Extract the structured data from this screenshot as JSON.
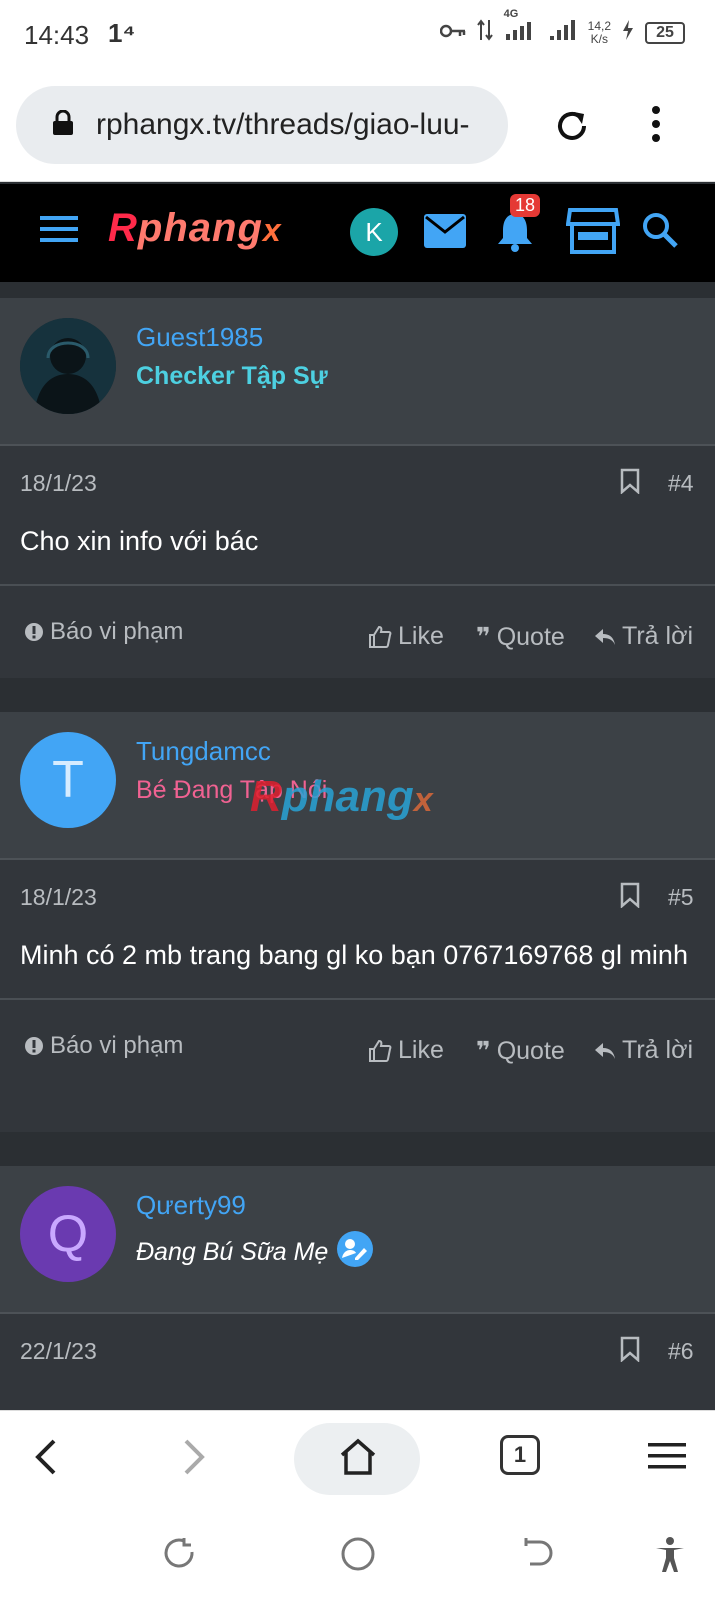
{
  "status_bar": {
    "time": "14:43",
    "extra": "1⁴",
    "network": "4G",
    "speed_value": "14,2",
    "speed_unit": "K/s",
    "battery": "25"
  },
  "browser": {
    "url": "rphangx.tv/threads/giao-luu-"
  },
  "site": {
    "logo_r": "R",
    "logo_phang": "phang",
    "logo_x": "x",
    "user_initial": "K",
    "notification_count": "18"
  },
  "posts": [
    {
      "username": "Guest1985",
      "title": "Checker Tập Sự",
      "title_color": "#4dd0e1",
      "date": "18/1/23",
      "number": "#4",
      "body": "Cho xin info với bác"
    },
    {
      "username": "Tungdamcc",
      "title": "Bé Đang Tập Nói",
      "title_color": "#f06292",
      "avatar_letter": "T",
      "avatar_color": "#42a5f5",
      "date": "18/1/23",
      "number": "#5",
      "body": "Minh có 2 mb trang bang gl ko bạn 0767169768 gl minh"
    },
    {
      "username": "Qưerty99",
      "title": "Đang Bú Sữa Mẹ",
      "title_color": "#ffffff",
      "avatar_letter": "Q",
      "avatar_color": "#6a3ab0",
      "date": "22/1/23",
      "number": "#6"
    }
  ],
  "actions": {
    "report": "Báo vi phạm",
    "like": "Like",
    "quote": "Quote",
    "reply": "Trả lời"
  },
  "bottom_nav": {
    "tab_count": "1"
  },
  "colors": {
    "accent": "#42a5f5",
    "header_bg": "#000000",
    "post_bg": "#32363b"
  }
}
